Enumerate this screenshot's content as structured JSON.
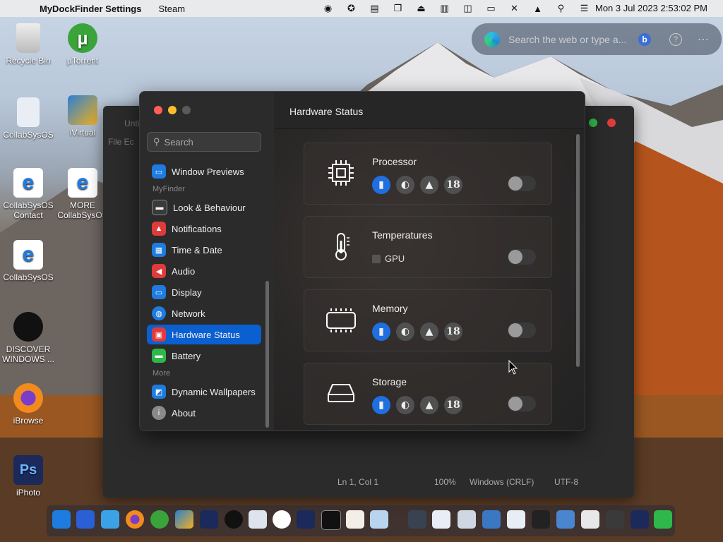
{
  "menubar": {
    "app_name": "MyDockFinder Settings",
    "menu_steam": "Steam",
    "clock": "Mon 3 Jul 2023 2:53:02 PM"
  },
  "search_widget": {
    "placeholder": "Search the web or type a..."
  },
  "desktop_icons": [
    {
      "label": "Recycle Bin"
    },
    {
      "label": "µTorrent"
    },
    {
      "label": "CollabSysOS"
    },
    {
      "label": "iVirtual"
    },
    {
      "label": "CollabSysOS Contact"
    },
    {
      "label": "MORE CollabSysOS"
    },
    {
      "label": "CollabSysOS"
    },
    {
      "label": "DISCOVER WINDOWS ..."
    },
    {
      "label": "iBrowse"
    },
    {
      "label": "iPhoto"
    }
  ],
  "notepad": {
    "title": "Unti",
    "menu": "File  Ec",
    "status": {
      "position": "Ln 1, Col 1",
      "zoom": "100%",
      "line_endings": "Windows (CRLF)",
      "encoding": "UTF-8"
    }
  },
  "settings": {
    "search_placeholder": "Search",
    "sections": {
      "myfinder": "MyFinder",
      "more": "More"
    },
    "nav": [
      {
        "label": "Window Previews",
        "color": "#1e7be0"
      },
      {
        "label": "Look & Behaviour",
        "color": "#3a3a3a"
      },
      {
        "label": "Notifications",
        "color": "#e03b3b"
      },
      {
        "label": "Time & Date",
        "color": "#1e7be0"
      },
      {
        "label": "Audio",
        "color": "#e03b3b"
      },
      {
        "label": "Display",
        "color": "#1e7be0"
      },
      {
        "label": "Network",
        "color": "#1e7be0"
      },
      {
        "label": "Hardware Status",
        "color": "#e03b3b",
        "active": true
      },
      {
        "label": "Battery",
        "color": "#2fb84a"
      },
      {
        "label": "Dynamic Wallpapers",
        "color": "#1e7be0"
      },
      {
        "label": "About",
        "color": "#8a8a8a"
      }
    ],
    "content": {
      "title": "Hardware Status",
      "cards": [
        {
          "label": "Processor",
          "opt_number": "18",
          "enabled": false
        },
        {
          "label": "Temperatures",
          "checkbox_label": "GPU",
          "enabled": false
        },
        {
          "label": "Memory",
          "opt_number": "18",
          "enabled": false
        },
        {
          "label": "Storage",
          "opt_number": "18",
          "enabled": false
        }
      ]
    }
  },
  "colors": {
    "accent": "#0a5fd1",
    "traffic_red": "#ff5f57",
    "traffic_yellow": "#febc2e",
    "traffic_gray": "#5a5a5a"
  }
}
